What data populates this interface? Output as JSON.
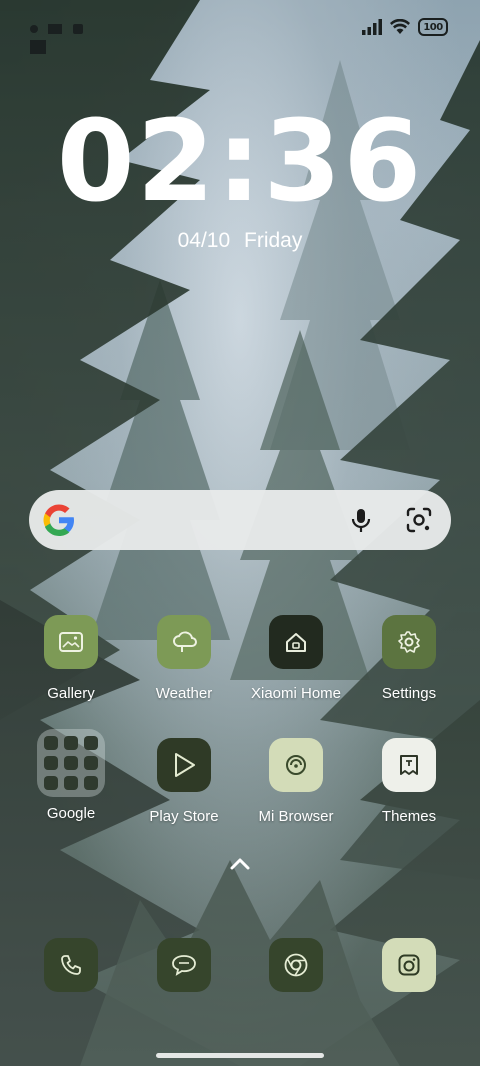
{
  "status_bar": {
    "battery_level": "100",
    "signal_icon": "cellular-signal-icon",
    "wifi_icon": "wifi-icon"
  },
  "lock": {
    "time": "02:36",
    "date": "04/10",
    "weekday": "Friday"
  },
  "search": {
    "logo_icon": "google-g-icon",
    "voice_icon": "microphone-icon",
    "lens_icon": "google-lens-icon"
  },
  "apps_row1": [
    {
      "label": "Gallery",
      "icon": "gallery-icon",
      "color": "#7d9a56"
    },
    {
      "label": "Weather",
      "icon": "cloud-icon",
      "color": "#7d9a56"
    },
    {
      "label": "Xiaomi Home",
      "icon": "home-icon",
      "color": "#222a1f"
    },
    {
      "label": "Settings",
      "icon": "gear-icon",
      "color": "#5c7440"
    }
  ],
  "apps_row2": [
    {
      "label": "Google",
      "icon": "folder-icon",
      "color": "#c8d0cc"
    },
    {
      "label": "Play Store",
      "icon": "play-icon",
      "color": "#2f3a26"
    },
    {
      "label": "Mi Browser",
      "icon": "browser-icon",
      "color": "#d3dcb8"
    },
    {
      "label": "Themes",
      "icon": "themes-icon",
      "color": "#eef0ea"
    }
  ],
  "dock": [
    {
      "icon": "phone-icon",
      "color": "#36452c"
    },
    {
      "icon": "messages-icon",
      "color": "#36452c"
    },
    {
      "icon": "chrome-icon",
      "color": "#36452c"
    },
    {
      "icon": "camera-icon",
      "color": "#d3dcb8"
    }
  ],
  "app_drawer_icon": "chevron-up-icon"
}
